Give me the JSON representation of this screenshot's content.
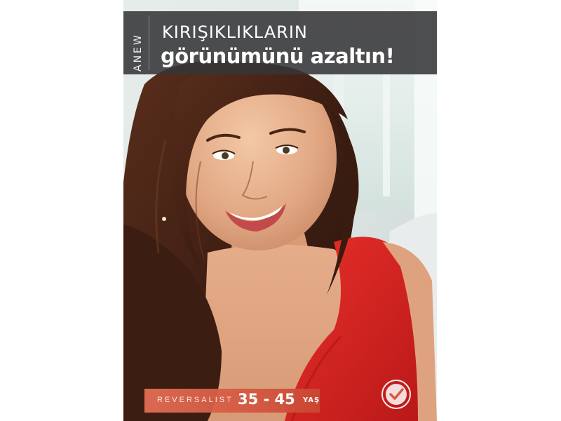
{
  "ad": {
    "brand": "ANEW",
    "headline_line1": "KIRIŞIKLIKLARIN",
    "headline_line2": "görünümünü azaltın!",
    "product_line": "REVERSALIST",
    "age_range": "35 - 45",
    "age_unit": "YAŞ",
    "photo_icon": "smiling-woman-portrait",
    "badge_icon": "checkmark-seal-icon",
    "colors": {
      "title_band": "#363638",
      "age_band": "#d85a40",
      "dress": "#d9201f",
      "background": "#e9eeee"
    }
  }
}
